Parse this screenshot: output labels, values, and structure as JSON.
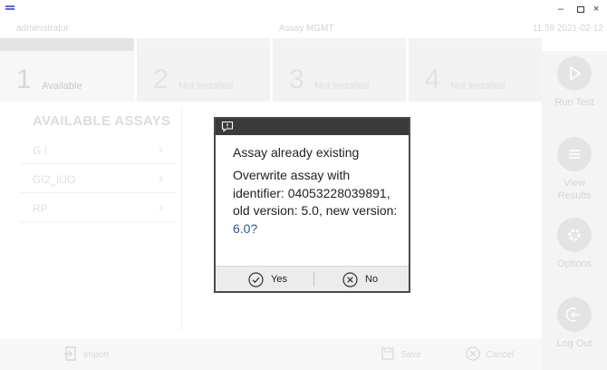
{
  "header": {
    "user": "administrator",
    "assay": "Assay MGMT",
    "clock": "11:59 2021-02-12"
  },
  "slots": [
    {
      "number": "1",
      "label": "Available"
    },
    {
      "number": "2",
      "label": "Not installed"
    },
    {
      "number": "3",
      "label": "Not installed"
    },
    {
      "number": "4",
      "label": "Not installed"
    }
  ],
  "assays": {
    "title": "AVAILABLE ASSAYS",
    "items": [
      {
        "name": "G I"
      },
      {
        "name": "GI2_IUO"
      },
      {
        "name": "RP"
      }
    ]
  },
  "bottombar": {
    "import_label": "Import",
    "save_label": "Save",
    "cancel_label": "Cancel"
  },
  "sidebar": {
    "run_test": "Run Test",
    "view_results": "View Results",
    "options": "Options",
    "log_out": "Log Out"
  },
  "dialog": {
    "title": "Assay already existing",
    "message_main": "Overwrite assay with identifier: 04053228039891, old version: 5.0, new version: ",
    "message_tail": "6.0?",
    "yes_label": "Yes",
    "no_label": "No"
  },
  "icons": {
    "run_test": "play-icon",
    "view_results": "list-icon",
    "options": "gear-icon",
    "log_out": "logout-icon",
    "import": "import-icon",
    "save": "save-icon",
    "cancel": "cancel-icon",
    "dialog": "message-icon",
    "yes": "check-circle-icon",
    "no": "x-circle-icon"
  }
}
